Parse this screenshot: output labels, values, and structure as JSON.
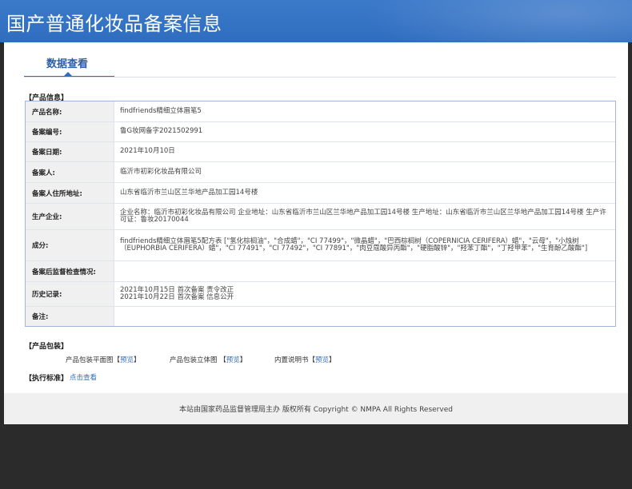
{
  "header": {
    "title": "国产普通化妆品备案信息"
  },
  "tabs": [
    {
      "label": "数据查看"
    }
  ],
  "sections": {
    "product_info": "【产品信息】",
    "packaging": "【产品包装】",
    "standard": "【执行标准】"
  },
  "product": [
    {
      "label": "产品名称:",
      "value": "findfriends精细立体眉笔5"
    },
    {
      "label": "备案编号:",
      "value": "鲁G妆网备字2021502991"
    },
    {
      "label": "备案日期:",
      "value": "2021年10月10日"
    },
    {
      "label": "备案人:",
      "value": "临沂市初彩化妆品有限公司"
    },
    {
      "label": "备案人住所地址:",
      "value": "山东省临沂市兰山区兰华地产品加工园14号楼"
    },
    {
      "label": "生产企业:",
      "value": "企业名称：临沂市初彩化妆品有限公司 企业地址：山东省临沂市兰山区兰华地产品加工园14号楼 生产地址：山东省临沂市兰山区兰华地产品加工园14号楼 生产许可证：鲁妆20170044"
    },
    {
      "label": "成分:",
      "value": "findfriends精细立体眉笔5配方表 [\"氢化棕榈油\"，\"合成蜡\"，\"CI 77499\"，\"微晶蜡\"，\"巴西棕榈树（COPERNICIA CERIFERA）蜡\"，\"云母\"，\"小烛树（EUPHORBIA CERIFERA）蜡\"，\"CI 77491\"，\"CI 77492\"，\"CI 77891\"，\"肉豆蔻酸异丙酯\"，\"硬脂酸锌\"，\"羟苯丁酯\"，\"丁羟甲苯\"，\"生育酚乙酸酯\"]"
    },
    {
      "label": "备案后监督检查情况:",
      "value": ""
    },
    {
      "label": "历史记录:",
      "value": "2021年10月15日 首次备案 责令改正\n2021年10月22日 首次备案 信息公开"
    },
    {
      "label": "备注:",
      "value": ""
    }
  ],
  "packaging": {
    "flat_label": "产品包装平面图",
    "solid_label": "产品包装立体图",
    "manual_label": "内置说明书",
    "bracket_open": "【",
    "preview": "预览",
    "bracket_close": "】"
  },
  "standard": {
    "link": "点击查看"
  },
  "footer": {
    "text": "本站由国家药品监督管理局主办 版权所有 Copyright © NMPA All Rights Reserved"
  }
}
